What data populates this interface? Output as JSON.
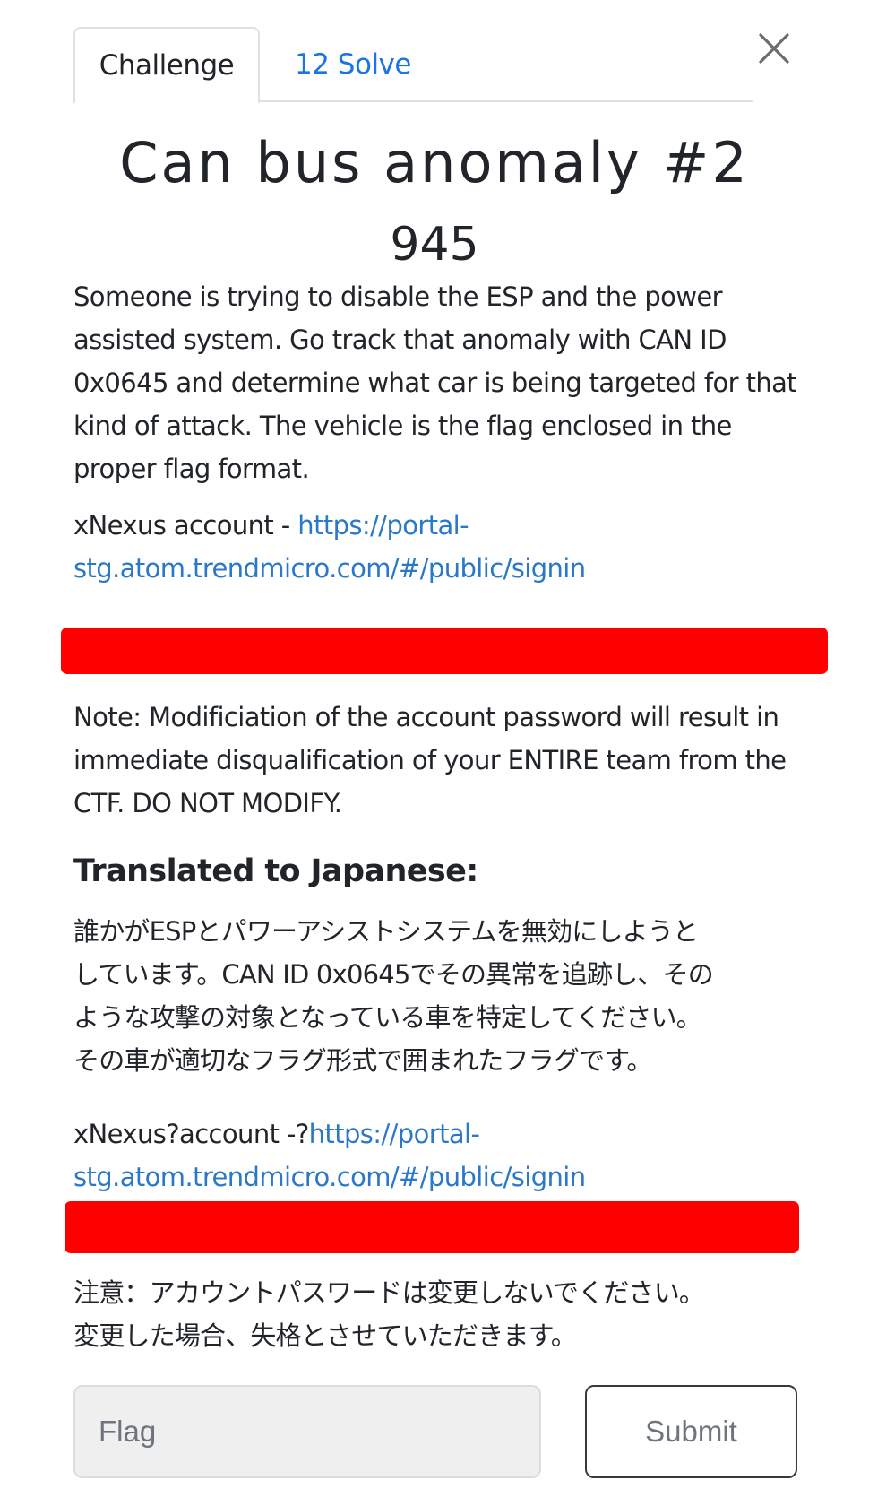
{
  "tabs": {
    "challenge_label": "Challenge",
    "solves_label": "12 Solve"
  },
  "challenge": {
    "title": "Can bus anomaly #2",
    "points": "945",
    "description": "Someone is trying to disable the ESP and the power assisted system. Go track that anomaly with CAN ID 0x0645 and determine what car is being targeted for that kind of attack. The vehicle is the flag enclosed in the proper flag format.",
    "account_prefix_en": "xNexus account - ",
    "account_link_line1": "https://portal-",
    "account_link_line2": "stg.atom.trendmicro.com/#/public/signin",
    "note_en": "Note: Modificiation of the account password will result in immediate disqualification of your ENTIRE team from the CTF. DO NOT MODIFY.",
    "jp_heading": "Translated to Japanese:",
    "jp_line1": "誰かがESPとパワーアシストシステムを無効にしようと",
    "jp_line2": "しています。CAN ID 0x0645でその異常を追跡し、その",
    "jp_line3": "ような攻撃の対象となっている車を特定してください。",
    "jp_line4": "その車が適切なフラグ形式で囲まれたフラグです。",
    "account_prefix_jp": "xNexus?account -?",
    "note_jp_line1": "注意：アカウントパスワードは変更しないでください。",
    "note_jp_line2": "変更した場合、失格とさせていただきます。"
  },
  "form": {
    "flag_placeholder": "Flag",
    "submit_label": "Submit"
  },
  "colors": {
    "link": "#2a78c8",
    "tab_link": "#1a73e8",
    "redaction": "#ff0000"
  }
}
